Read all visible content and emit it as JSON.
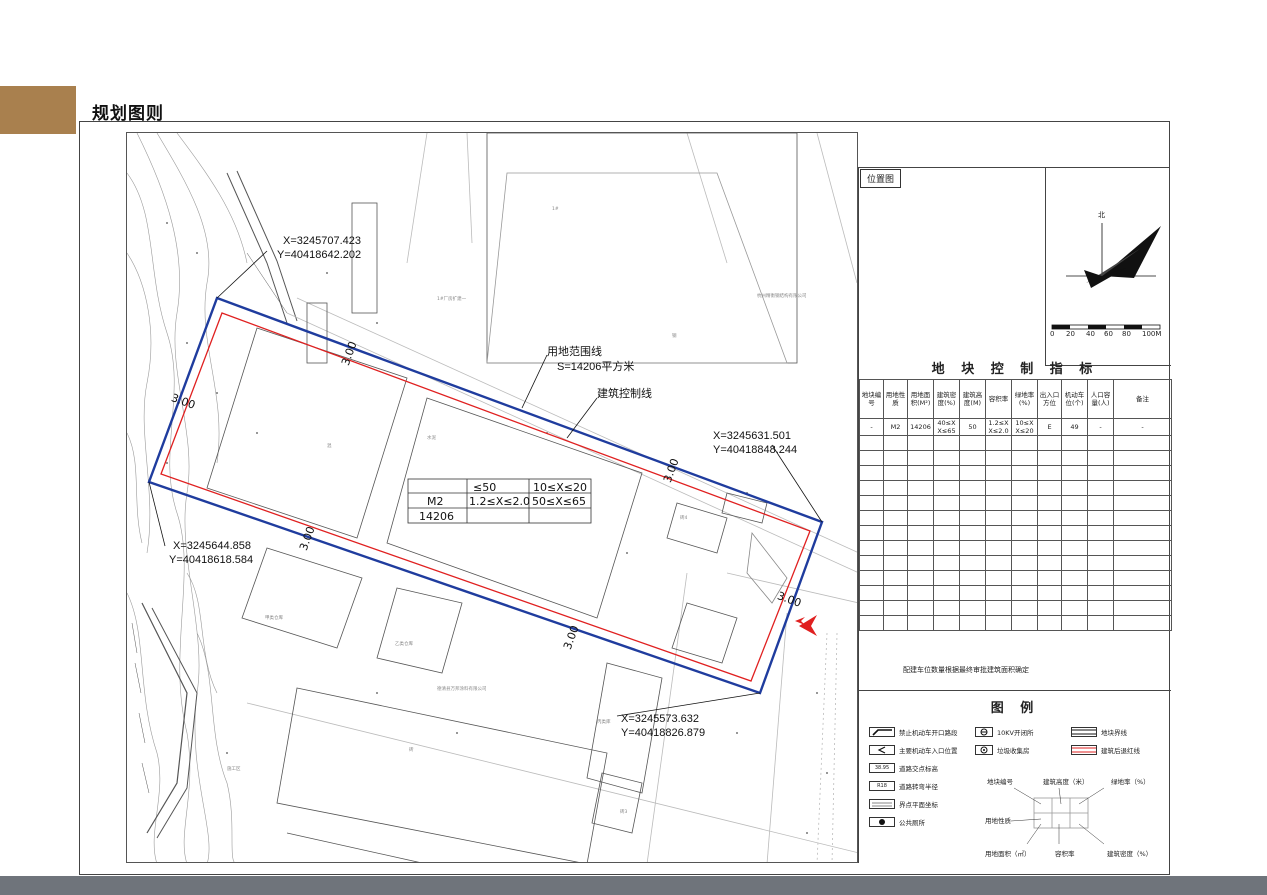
{
  "page": {
    "title": "规划图则"
  },
  "map": {
    "boundary_label": "用地范围线",
    "boundary_area": "S=14206平方米",
    "setback_label": "建筑控制线",
    "corners": [
      {
        "x": "X=3245707.423",
        "y": "Y=40418642.202"
      },
      {
        "x": "X=3245631.501",
        "y": "Y=40418848.244"
      },
      {
        "x": "X=3245644.858",
        "y": "Y=40418618.584"
      },
      {
        "x": "X=3245573.632",
        "y": "Y=40418826.879"
      }
    ],
    "setbacks": [
      "3.00",
      "3.00",
      "3.00",
      "3.00",
      "3.00",
      "3.00"
    ],
    "plot_table": {
      "r1": [
        "",
        "≤50",
        "10≤X≤20"
      ],
      "r2": [
        "M2",
        "1.2≤X≤2.0",
        "50≤X≤65"
      ],
      "r3": [
        "14206",
        "",
        ""
      ]
    },
    "labels": [
      "1#厂房扩建一",
      "杭州精衡钢结构有限公司",
      "甲类仓库",
      "乙类仓库",
      "德清县万邦涂料有限公司",
      "丙类库",
      "施工区",
      "砖",
      "混",
      "水泥",
      "砖4",
      "砖3",
      "钢",
      "1#"
    ]
  },
  "side": {
    "location_label": "位置图",
    "north": "北",
    "scale": [
      "0",
      "20",
      "40",
      "60",
      "80",
      "100M"
    ],
    "indicators_title": "地 块 控 制 指 标",
    "table_headers": [
      "地块编号",
      "用地性质",
      "用地面积(M²)",
      "建筑密度(%)",
      "建筑高度(M)",
      "容积率",
      "绿地率(%)",
      "出入口方位",
      "机动车位(个)",
      "人口容量(人)",
      "备注"
    ],
    "table_row": [
      "-",
      "M2",
      "14206",
      "40≤X X≤65",
      "50",
      "1.2≤X X≤2.0",
      "10≤X X≤20",
      "E",
      "49",
      "-",
      "-"
    ],
    "note": "配建车位数量根据最终审批建筑面积确定",
    "legend_title": "图 例",
    "legend": [
      {
        "sym": "",
        "label": "禁止机动车开口路段"
      },
      {
        "sym": "",
        "label": "10KV开闭所"
      },
      {
        "sym": "",
        "label": "地块界线"
      },
      {
        "sym": "",
        "label": "主要机动车入口位置"
      },
      {
        "sym": "",
        "label": "垃圾收集房"
      },
      {
        "sym": "",
        "label": "建筑后退红线"
      },
      {
        "sym": "38.95",
        "label": "道路交点标高"
      },
      {
        "sym": "R18",
        "label": "道路转弯半径"
      },
      {
        "sym": "",
        "label": "界点平面坐标"
      },
      {
        "sym": "",
        "label": "公共厕所"
      }
    ],
    "diagram": {
      "plot_code": "地块编号",
      "height": "建筑高度（米）",
      "green": "绿地率（%）",
      "use": "用地性质",
      "area": "用地面积（㎡）",
      "far": "容积率",
      "density": "建筑密度（%）"
    }
  },
  "colors": {
    "boundary": "#1f3c9e",
    "setback": "#e02020",
    "accent": "#a9804e"
  }
}
